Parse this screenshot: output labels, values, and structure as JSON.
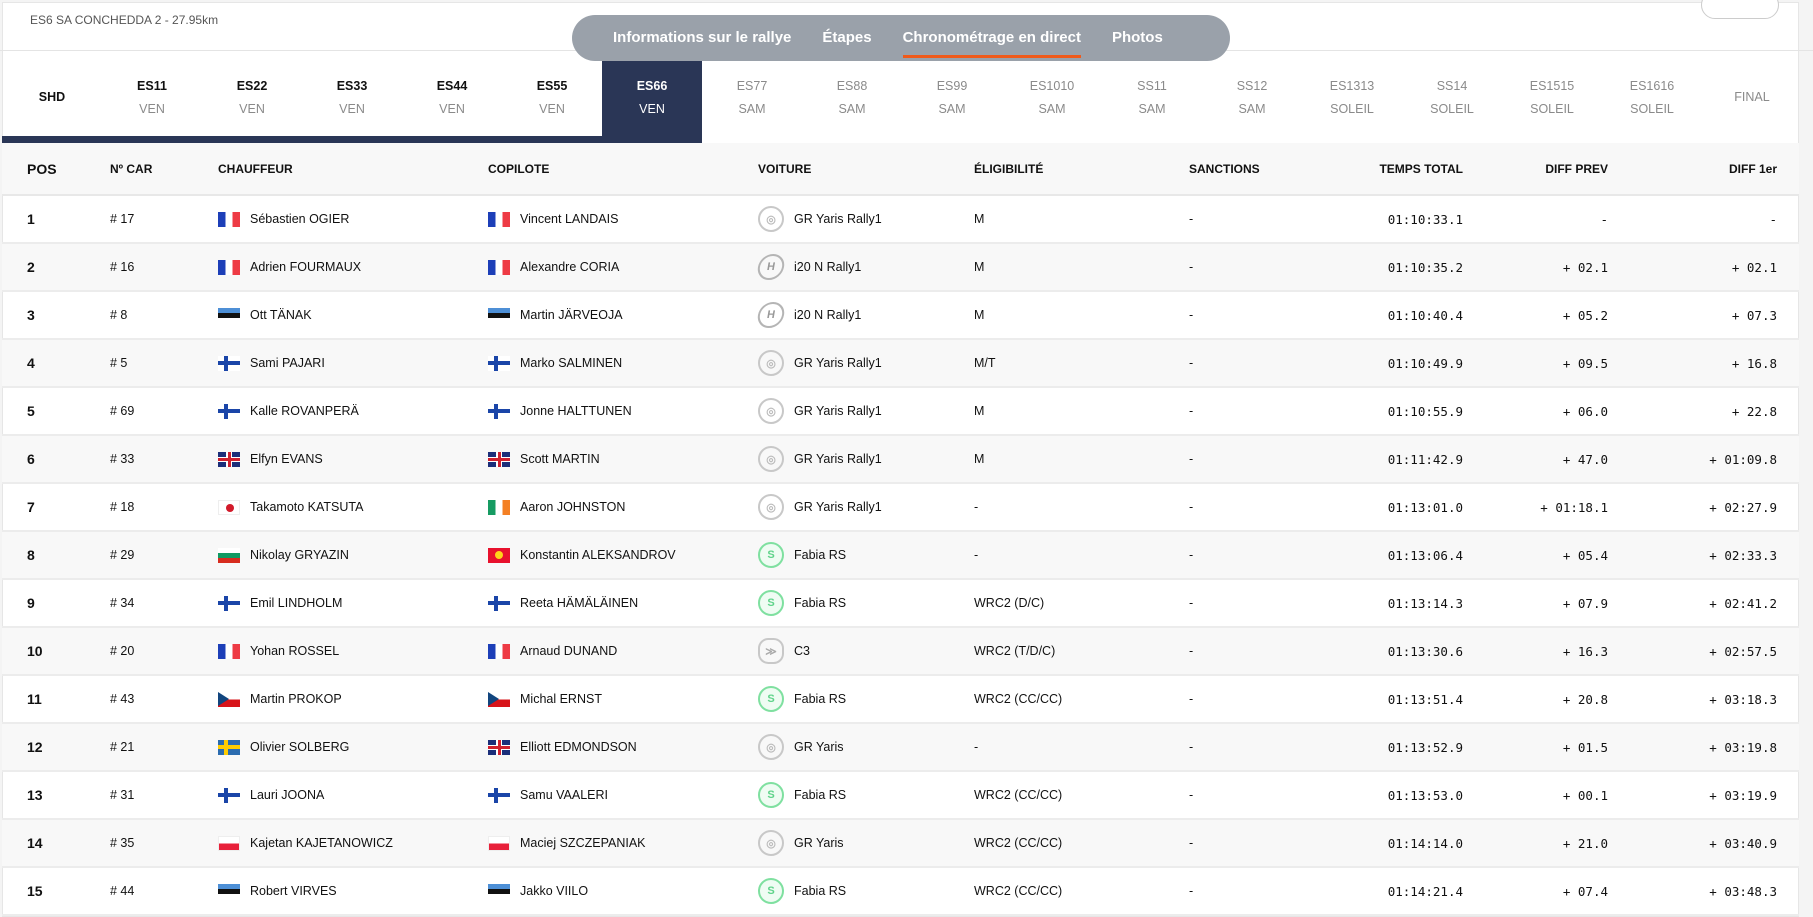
{
  "stage_title": "ES6 SA CONCHEDDA 2 - 27.95km",
  "nav": [
    {
      "label": "Informations sur le rallye",
      "active": false
    },
    {
      "label": "Étapes",
      "active": false
    },
    {
      "label": "Chronométrage en direct",
      "active": true
    },
    {
      "label": "Photos",
      "active": false
    }
  ],
  "stages": [
    {
      "n": "SHD",
      "d": ""
    },
    {
      "n": "ES11",
      "d": "VEN"
    },
    {
      "n": "ES22",
      "d": "VEN"
    },
    {
      "n": "ES33",
      "d": "VEN"
    },
    {
      "n": "ES44",
      "d": "VEN"
    },
    {
      "n": "ES55",
      "d": "VEN"
    },
    {
      "n": "ES66",
      "d": "VEN",
      "active": true
    },
    {
      "n": "ES77",
      "d": "SAM",
      "future": true
    },
    {
      "n": "ES88",
      "d": "SAM",
      "future": true
    },
    {
      "n": "ES99",
      "d": "SAM",
      "future": true
    },
    {
      "n": "ES1010",
      "d": "SAM",
      "future": true
    },
    {
      "n": "SS11",
      "d": "SAM",
      "future": true
    },
    {
      "n": "SS12",
      "d": "SAM",
      "future": true
    },
    {
      "n": "ES1313",
      "d": "SOLEIL",
      "future": true
    },
    {
      "n": "SS14",
      "d": "SOLEIL",
      "future": true
    },
    {
      "n": "ES1515",
      "d": "SOLEIL",
      "future": true
    },
    {
      "n": "ES1616",
      "d": "SOLEIL",
      "future": true
    },
    {
      "n": "FINAL",
      "d": "",
      "future": true
    }
  ],
  "columns": {
    "pos": "POS",
    "car": "Nº CAR",
    "driver": "CHAUFFEUR",
    "codriver": "COPILOTE",
    "vehicle": "VOITURE",
    "elig": "ÉLIGIBILITÉ",
    "sanctions": "SANCTIONS",
    "time": "TEMPS TOTAL",
    "diff_prev": "DIFF PREV",
    "diff_first": "DIFF 1er"
  },
  "rows": [
    {
      "pos": "1",
      "car": "# 17",
      "driver": "Sébastien OGIER",
      "df": "fr",
      "codriver": "Vincent LANDAIS",
      "cf": "fr",
      "brand": "toyota",
      "vehicle": "GR Yaris Rally1",
      "elig": "M",
      "sanctions": "-",
      "time": "01:10:33.1",
      "diff_prev": "-",
      "diff_first": "-"
    },
    {
      "pos": "2",
      "car": "# 16",
      "driver": "Adrien FOURMAUX",
      "df": "fr",
      "codriver": "Alexandre CORIA",
      "cf": "fr",
      "brand": "hyundai",
      "vehicle": "i20 N Rally1",
      "elig": "M",
      "sanctions": "-",
      "time": "01:10:35.2",
      "diff_prev": "+ 02.1",
      "diff_first": "+ 02.1"
    },
    {
      "pos": "3",
      "car": "# 8",
      "driver": "Ott TÄNAK",
      "df": "ee",
      "codriver": "Martin JÄRVEOJA",
      "cf": "ee",
      "brand": "hyundai",
      "vehicle": "i20 N Rally1",
      "elig": "M",
      "sanctions": "-",
      "time": "01:10:40.4",
      "diff_prev": "+ 05.2",
      "diff_first": "+ 07.3"
    },
    {
      "pos": "4",
      "car": "# 5",
      "driver": "Sami PAJARI",
      "df": "fi",
      "codriver": "Marko SALMINEN",
      "cf": "fi",
      "brand": "toyota",
      "vehicle": "GR Yaris Rally1",
      "elig": "M/T",
      "sanctions": "-",
      "time": "01:10:49.9",
      "diff_prev": "+ 09.5",
      "diff_first": "+ 16.8"
    },
    {
      "pos": "5",
      "car": "# 69",
      "driver": "Kalle ROVANPERÄ",
      "df": "fi",
      "codriver": "Jonne HALTTUNEN",
      "cf": "fi",
      "brand": "toyota",
      "vehicle": "GR Yaris Rally1",
      "elig": "M",
      "sanctions": "-",
      "time": "01:10:55.9",
      "diff_prev": "+ 06.0",
      "diff_first": "+ 22.8"
    },
    {
      "pos": "6",
      "car": "# 33",
      "driver": "Elfyn EVANS",
      "df": "gb",
      "codriver": "Scott MARTIN",
      "cf": "gb",
      "brand": "toyota",
      "vehicle": "GR Yaris Rally1",
      "elig": "M",
      "sanctions": "-",
      "time": "01:11:42.9",
      "diff_prev": "+ 47.0",
      "diff_first": "+ 01:09.8"
    },
    {
      "pos": "7",
      "car": "# 18",
      "driver": "Takamoto KATSUTA",
      "df": "jp",
      "codriver": "Aaron JOHNSTON",
      "cf": "ie",
      "brand": "toyota",
      "vehicle": "GR Yaris Rally1",
      "elig": "-",
      "sanctions": "-",
      "time": "01:13:01.0",
      "diff_prev": "+ 01:18.1",
      "diff_first": "+ 02:27.9"
    },
    {
      "pos": "8",
      "car": "# 29",
      "driver": "Nikolay GRYAZIN",
      "df": "bg",
      "codriver": "Konstantin ALEKSANDROV",
      "cf": "kg",
      "brand": "skoda",
      "vehicle": "Fabia RS",
      "elig": "-",
      "sanctions": "-",
      "time": "01:13:06.4",
      "diff_prev": "+ 05.4",
      "diff_first": "+ 02:33.3"
    },
    {
      "pos": "9",
      "car": "# 34",
      "driver": "Emil LINDHOLM",
      "df": "fi",
      "codriver": "Reeta HÄMÄLÄINEN",
      "cf": "fi",
      "brand": "skoda",
      "vehicle": "Fabia RS",
      "elig": "WRC2 (D/C)",
      "sanctions": "-",
      "time": "01:13:14.3",
      "diff_prev": "+ 07.9",
      "diff_first": "+ 02:41.2"
    },
    {
      "pos": "10",
      "car": "# 20",
      "driver": "Yohan ROSSEL",
      "df": "fr",
      "codriver": "Arnaud DUNAND",
      "cf": "fr",
      "brand": "citroen",
      "vehicle": "C3",
      "elig": "WRC2 (T/D/C)",
      "sanctions": "-",
      "time": "01:13:30.6",
      "diff_prev": "+ 16.3",
      "diff_first": "+ 02:57.5"
    },
    {
      "pos": "11",
      "car": "# 43",
      "driver": "Martin PROKOP",
      "df": "cz",
      "codriver": "Michal ERNST",
      "cf": "cz",
      "brand": "skoda",
      "vehicle": "Fabia RS",
      "elig": "WRC2 (CC/CC)",
      "sanctions": "-",
      "time": "01:13:51.4",
      "diff_prev": "+ 20.8",
      "diff_first": "+ 03:18.3"
    },
    {
      "pos": "12",
      "car": "# 21",
      "driver": "Olivier SOLBERG",
      "df": "se",
      "codriver": "Elliott EDMONDSON",
      "cf": "gb",
      "brand": "toyota",
      "vehicle": "GR Yaris",
      "elig": "-",
      "sanctions": "-",
      "time": "01:13:52.9",
      "diff_prev": "+ 01.5",
      "diff_first": "+ 03:19.8"
    },
    {
      "pos": "13",
      "car": "# 31",
      "driver": "Lauri JOONA",
      "df": "fi",
      "codriver": "Samu VAALERI",
      "cf": "fi",
      "brand": "skoda",
      "vehicle": "Fabia RS",
      "elig": "WRC2 (CC/CC)",
      "sanctions": "-",
      "time": "01:13:53.0",
      "diff_prev": "+ 00.1",
      "diff_first": "+ 03:19.9"
    },
    {
      "pos": "14",
      "car": "# 35",
      "driver": "Kajetan KAJETANOWICZ",
      "df": "pl",
      "codriver": "Maciej SZCZEPANIAK",
      "cf": "pl",
      "brand": "toyota",
      "vehicle": "GR Yaris",
      "elig": "WRC2 (CC/CC)",
      "sanctions": "-",
      "time": "01:14:14.0",
      "diff_prev": "+ 21.0",
      "diff_first": "+ 03:40.9"
    },
    {
      "pos": "15",
      "car": "# 44",
      "driver": "Robert VIRVES",
      "df": "ee",
      "codriver": "Jakko VIILO",
      "cf": "ee",
      "brand": "skoda",
      "vehicle": "Fabia RS",
      "elig": "WRC2 (CC/CC)",
      "sanctions": "-",
      "time": "01:14:21.4",
      "diff_prev": "+ 07.4",
      "diff_first": "+ 03:48.3"
    }
  ]
}
